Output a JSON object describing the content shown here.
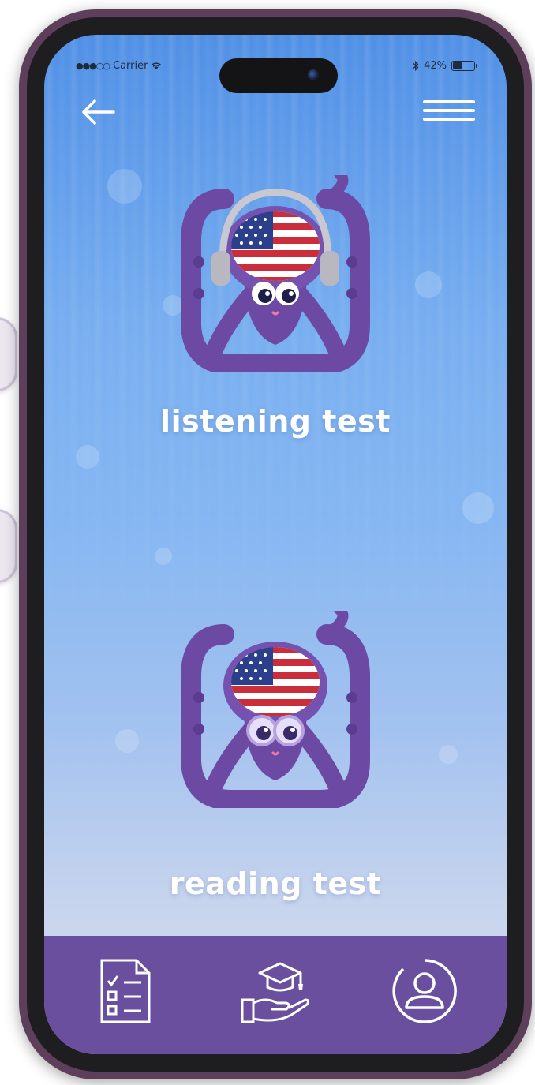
{
  "status_bar": {
    "signal_dots": "●●●○○",
    "carrier": "Carrier",
    "wifi_icon": "wifi-icon",
    "bluetooth_icon": "bluetooth-icon",
    "battery_percent": "42%",
    "battery_level": 0.42
  },
  "header": {
    "back_icon": "arrow-left-icon",
    "menu_icon": "hamburger-menu-icon"
  },
  "tests": [
    {
      "label": "listening test",
      "mascot": "octopus-headphones-flag"
    },
    {
      "label": "reading test",
      "mascot": "octopus-glasses-flag"
    }
  ],
  "bottom_nav": {
    "items": [
      {
        "icon": "checklist-icon"
      },
      {
        "icon": "graduation-cap-hand-icon"
      },
      {
        "icon": "user-profile-icon"
      }
    ]
  },
  "colors": {
    "mascot_purple": "#6c4aa3",
    "nav_bar": "#6a4f9e",
    "frame": "#5d3f5c",
    "sky_top": "#4f8fe6",
    "sky_bottom": "#d7dcec"
  }
}
